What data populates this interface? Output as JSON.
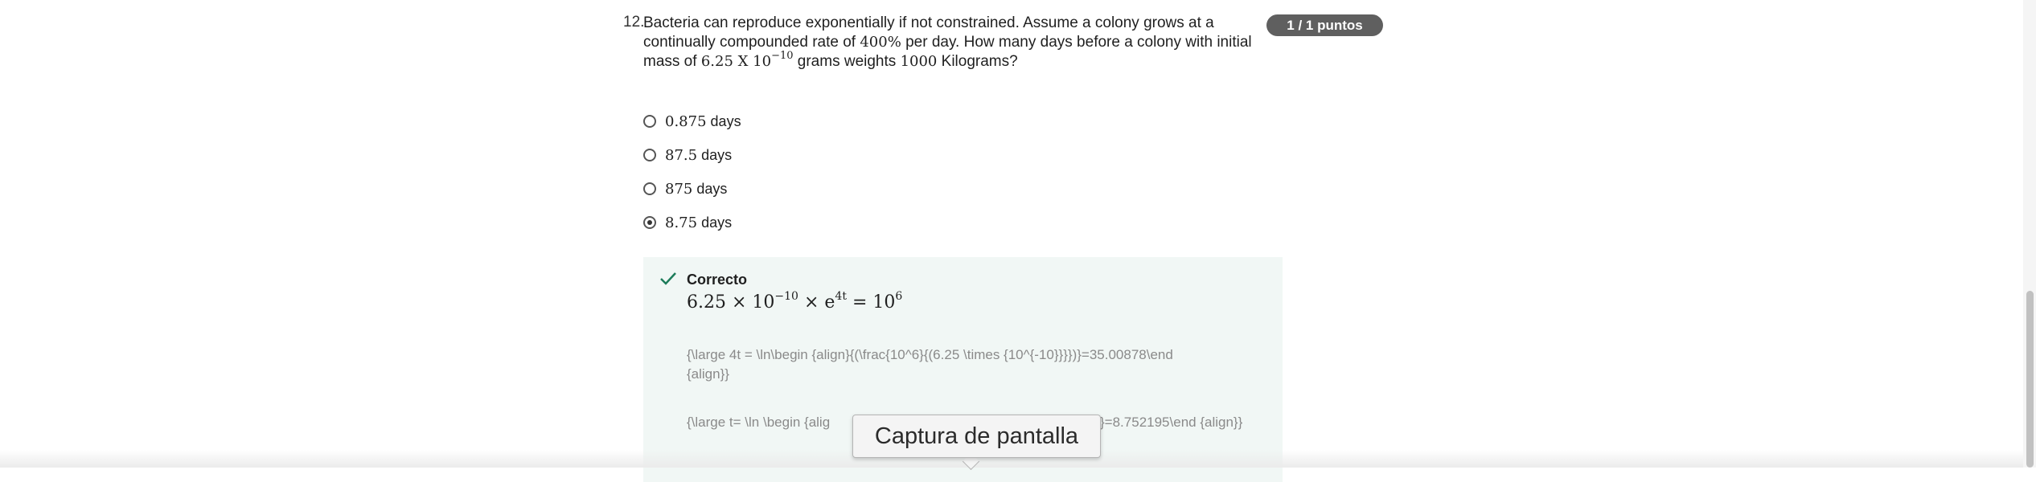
{
  "question": {
    "number": "12.",
    "text_part1": "Bacteria can reproduce exponentially if not constrained. Assume a colony grows at a continually compounded rate of",
    "rate": "400%",
    "text_part2": "per day. How many days before a colony with initial mass of",
    "mass_base": "6.25 X 10",
    "mass_exponent": "−10",
    "text_part3": "grams weights",
    "target_mass": "1000",
    "text_part4": "Kilograms?"
  },
  "score": {
    "label": "1 / 1 puntos"
  },
  "options": [
    {
      "value": "0.875",
      "unit": "days",
      "selected": false
    },
    {
      "value": "87.5",
      "unit": "days",
      "selected": false
    },
    {
      "value": "875",
      "unit": "days",
      "selected": false
    },
    {
      "value": "8.75",
      "unit": "days",
      "selected": true
    }
  ],
  "feedback": {
    "status": "Correcto",
    "equation_a": "6.25 × 10",
    "equation_a_exp": "−10",
    "equation_b": " × e",
    "equation_b_exp": "4t",
    "equation_c": " = 10",
    "equation_c_exp": "6",
    "latex_line1": "{\\large 4t = \\ln\\begin {align}{(\\frac{10^6}{(6.25 \\times {10^{-10}}}})}=35.00878\\end",
    "latex_line2": "{align}}",
    "latex_line3_left": "{\\large t= \\ln \\begin {alig",
    "latex_line3_right": "}=8.752195\\end {align}}"
  },
  "tooltip": {
    "label": "Captura de pantalla"
  },
  "colors": {
    "badge": "#5f5f5f",
    "feedback_bg": "#f1f7f5",
    "check": "#1d7c5a"
  }
}
